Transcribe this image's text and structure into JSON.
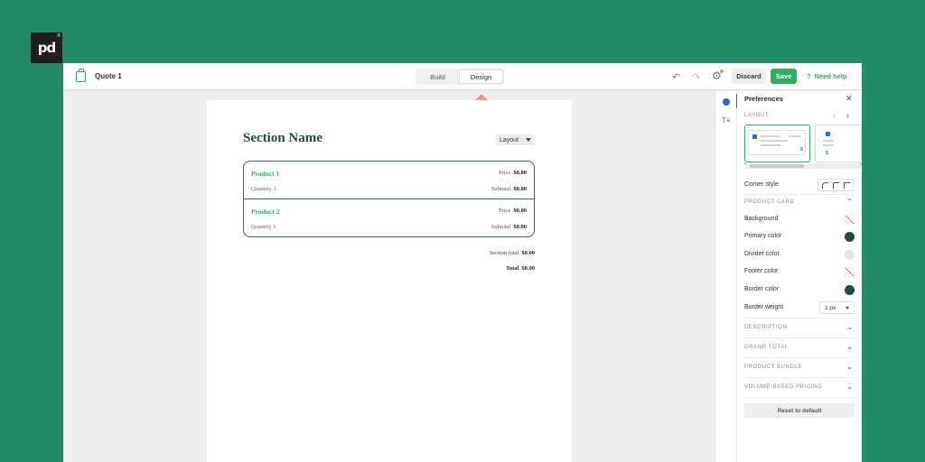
{
  "brand": {
    "logo_text": "pd",
    "logo_mark": "®"
  },
  "topbar": {
    "doc_icon": "bag-icon",
    "quote_title": "Quote 1",
    "tabs": [
      {
        "label": "Build",
        "active": false
      },
      {
        "label": "Design",
        "active": true
      }
    ],
    "undo_icon": "↶",
    "redo_icon": "↷",
    "settings_icon": "⚙",
    "discard_label": "Discard",
    "save_label": "Save",
    "help_icon": "?",
    "help_label": "Need help"
  },
  "canvas": {
    "section_name": "Section Name",
    "layout_dropdown": "Layout",
    "products": [
      {
        "name": "Product 1",
        "price_label": "Price",
        "price": "$0.00",
        "quantity_label": "Quantity 1",
        "subtotal_label": "Subtotal",
        "subtotal": "$0.00"
      },
      {
        "name": "Product 2",
        "price_label": "Price",
        "price": "$0.00",
        "quantity_label": "Quantity 1",
        "subtotal_label": "Subtotal",
        "subtotal": "$0.00"
      }
    ],
    "section_total_label": "Section total",
    "section_total": "$0.00",
    "total_label": "Total",
    "total": "$0.00"
  },
  "rail": {
    "text_tool_icon": "T≡"
  },
  "panel": {
    "title": "Preferences",
    "close_icon": "✕",
    "layout_caption": "LAYOUT",
    "layout_prev": "‹",
    "layout_next": "›",
    "thumb_dollar": "$",
    "scroll_prev": "‹",
    "scroll_next": "›",
    "corner_style_label": "Corner style",
    "product_card_caption": "PRODUCT CARD",
    "chevron_up": "⌃",
    "chevron_down": "⌄",
    "background_label": "Background",
    "primary_color_label": "Primary color",
    "divider_color_label": "Divider color",
    "footer_color_label": "Footer color",
    "border_color_label": "Border color",
    "border_weight_label": "Border weight",
    "border_weight_value": "1 px",
    "sections": [
      "DESCRIPTION",
      "GRAND TOTAL",
      "PRODUCT BUNDLE",
      "VOLUME-BASED PRICING"
    ],
    "reset_label": "Reset to default",
    "colors": {
      "primary": "#1e4b3d",
      "divider": "#e6e6e6",
      "border": "#1e4b3d",
      "accent": "#2fae5f",
      "background": "#228a65"
    }
  }
}
